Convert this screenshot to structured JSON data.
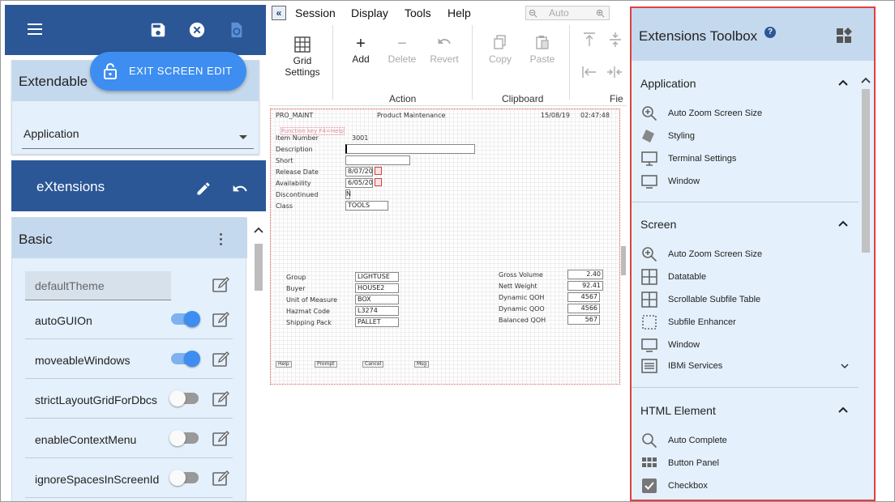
{
  "left_panel": {
    "exit_button": "EXIT SCREEN EDIT",
    "ext_card": {
      "title": "Extendable",
      "select_value": "Application"
    },
    "extensions_bar": {
      "title": "eXtensions"
    },
    "basic": {
      "title": "Basic",
      "theme_value": "defaultTheme",
      "props": [
        {
          "name": "autoGUIOn",
          "on": true
        },
        {
          "name": "moveableWindows",
          "on": true
        },
        {
          "name": "strictLayoutGridForDbcs",
          "on": false
        },
        {
          "name": "enableContextMenu",
          "on": false
        },
        {
          "name": "ignoreSpacesInScreenId",
          "on": false
        }
      ]
    }
  },
  "menu": {
    "items": [
      "Session",
      "Display",
      "Tools",
      "Help"
    ],
    "auto_field": "Auto"
  },
  "ribbon": {
    "grid_settings": "Grid Settings",
    "add": "Add",
    "delete": "Delete",
    "revert": "Revert",
    "copy": "Copy",
    "paste": "Paste",
    "group_action": "Action",
    "group_clipboard": "Clipboard",
    "group_field": "Fie"
  },
  "screen": {
    "program": "PRO_MAINT",
    "title": "Product Maintenance",
    "date": "15/08/19",
    "time": "02:47:48",
    "function_keys_msg": "Function key F4=Help",
    "labels": {
      "item_number": "Item Number",
      "description": "Description",
      "short": "Short",
      "release_date": "Release Date",
      "availability": "Availability",
      "discontinued": "Discontinued",
      "class": "Class",
      "group": "Group",
      "buyer": "Buyer",
      "uom": "Unit of Measure",
      "hazmat": "Hazmat Code",
      "shipping": "Shipping Pack",
      "gross_volume": "Gross Volume",
      "nett_weight": "Nett Weight",
      "dyn_qoh": "Dynamic QOH",
      "dyn_qoo": "Dynamic QOO",
      "bal_qoh": "Balanced QOH"
    },
    "values": {
      "item_number": "3001",
      "release_date": "8/07/20",
      "availability": "6/05/20",
      "discontinued": "N",
      "class": "TOOLS",
      "group": "LIGHTUSE",
      "buyer": "HOUSE2",
      "uom": "BOX",
      "hazmat": "L3274",
      "shipping": "PALLET",
      "gross_volume": "2.40",
      "nett_weight": "92.41",
      "dyn_qoh": "4567",
      "dyn_qoo": "4566",
      "bal_qoh": "567"
    },
    "fkeys": [
      "Help",
      "Prompt",
      "Cancel",
      "Msg"
    ]
  },
  "toolbox": {
    "title": "Extensions Toolbox",
    "sections": [
      {
        "name": "Application",
        "items": [
          "Auto Zoom Screen Size",
          "Styling",
          "Terminal Settings",
          "Window"
        ]
      },
      {
        "name": "Screen",
        "items": [
          "Auto Zoom Screen Size",
          "Datatable",
          "Scrollable Subfile Table",
          "Subfile Enhancer",
          "Window",
          "IBMi Services"
        ]
      },
      {
        "name": "HTML Element",
        "items": [
          "Auto Complete",
          "Button Panel",
          "Checkbox"
        ]
      }
    ]
  },
  "colors": {
    "primary": "#2b5797",
    "accent": "#3d8ef0",
    "panel": "#e4f0fb",
    "panel_header": "#c5d9ee",
    "highlight_border": "#e04040"
  }
}
